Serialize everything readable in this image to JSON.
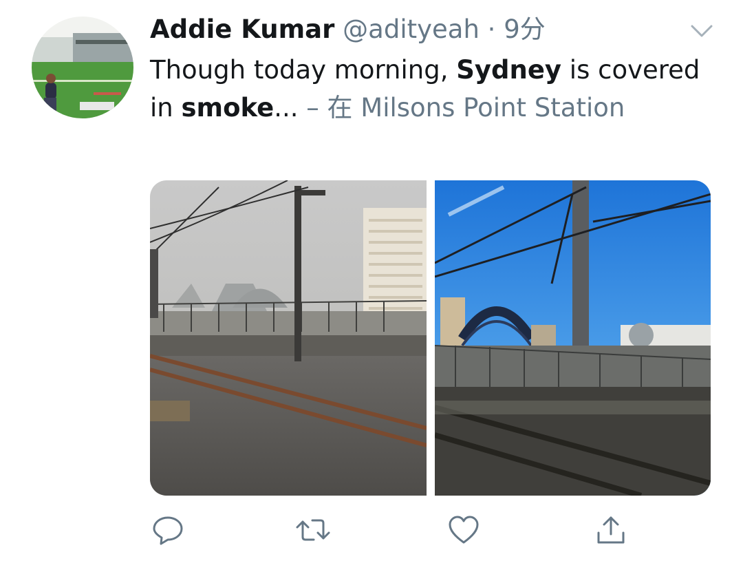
{
  "tweet": {
    "author_name": "Addie Kumar",
    "handle": "@adityeah",
    "separator": " · ",
    "time": "9分",
    "text_part1": "Though today morning, ",
    "text_bold1": "Sydney",
    "text_part2": " is covered in ",
    "text_bold2": "smoke",
    "text_ellipsis": "...",
    "location": " – 在 Milsons Point Station"
  },
  "icons": {
    "avatar": "profile-avatar",
    "more": "chevron-down-icon",
    "reply": "reply-icon",
    "retweet": "retweet-icon",
    "like": "heart-icon",
    "share": "share-icon"
  },
  "colors": {
    "text": "#14171a",
    "secondary": "#657786",
    "icon": "#657786"
  }
}
